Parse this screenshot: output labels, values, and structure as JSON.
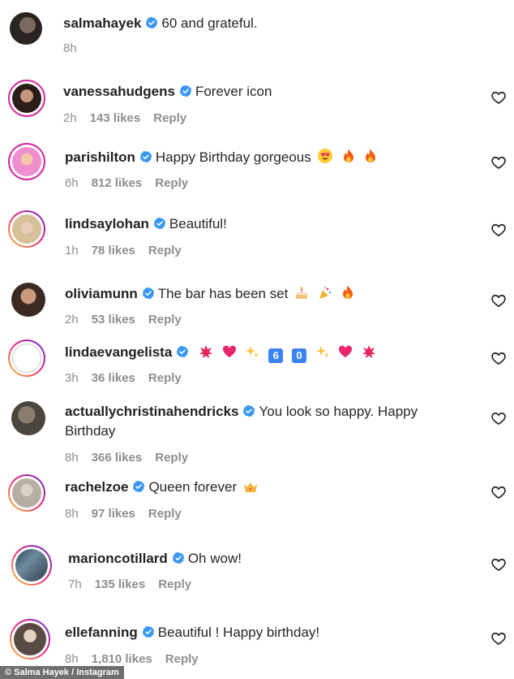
{
  "post": {
    "user": "salmahayek",
    "caption": "60 and grateful.",
    "time": "8h"
  },
  "comments": [
    {
      "user": "vanessahudgens",
      "text": "Forever icon",
      "time": "2h",
      "likes": "143 likes",
      "reply": "Reply"
    },
    {
      "user": "parishilton",
      "text": "Happy Birthday gorgeous",
      "time": "6h",
      "likes": "812 likes",
      "reply": "Reply"
    },
    {
      "user": "lindsaylohan",
      "text": "Beautiful!",
      "time": "1h",
      "likes": "78 likes",
      "reply": "Reply"
    },
    {
      "user": "oliviamunn",
      "text": "The bar has been set",
      "time": "2h",
      "likes": "53 likes",
      "reply": "Reply"
    },
    {
      "user": "lindaevangelista",
      "text": "",
      "time": "3h",
      "likes": "36 likes",
      "reply": "Reply"
    },
    {
      "user": "actuallychristinahendricks",
      "text": "You look so happy. Happy",
      "text2": "Birthday",
      "time": "8h",
      "likes": "366 likes",
      "reply": "Reply"
    },
    {
      "user": "rachelzoe",
      "text": "Queen forever",
      "time": "8h",
      "likes": "97 likes",
      "reply": "Reply"
    },
    {
      "user": "marioncotillard",
      "text": "Oh wow!",
      "time": "7h",
      "likes": "135 likes",
      "reply": "Reply"
    },
    {
      "user": "ellefanning",
      "text": "Beautiful ! Happy birthday!",
      "time": "8h",
      "likes": "1,810 likes",
      "reply": "Reply"
    }
  ],
  "linda_digits": [
    "6",
    "0"
  ],
  "credit": "© Salma Hayek / Instagram",
  "colors": {
    "verified": "#3897f0",
    "muted": "#8e8e8e",
    "ring": "#d6249f"
  }
}
